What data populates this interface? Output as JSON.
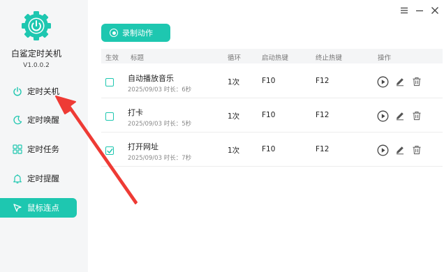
{
  "app": {
    "name": "白鲨定时关机",
    "version": "V1.0.0.2"
  },
  "sidebar": {
    "items": [
      {
        "label": "定时关机",
        "icon": "power-icon"
      },
      {
        "label": "定时唤醒",
        "icon": "moon-icon"
      },
      {
        "label": "定时任务",
        "icon": "grid-icon"
      },
      {
        "label": "定时提醒",
        "icon": "bell-icon"
      },
      {
        "label": "鼠标连点",
        "icon": "cursor-icon",
        "active": true
      }
    ]
  },
  "toolbar": {
    "record_label": "录制动作"
  },
  "table": {
    "headers": {
      "enabled": "生效",
      "title": "标题",
      "loop": "循环",
      "start_hotkey": "启动热键",
      "stop_hotkey": "终止热键",
      "actions": "操作"
    },
    "rows": [
      {
        "title": "自动播放音乐",
        "meta": "2025/09/03 时长：6秒",
        "loop": "1次",
        "start": "F10",
        "stop": "F12",
        "checked": false
      },
      {
        "title": "打卡",
        "meta": "2025/09/03 时长：5秒",
        "loop": "1次",
        "start": "F10",
        "stop": "F12",
        "checked": false
      },
      {
        "title": "打开网址",
        "meta": "2025/09/03 时长：7秒",
        "loop": "1次",
        "start": "F10",
        "stop": "F12",
        "checked": true
      }
    ]
  },
  "colors": {
    "accent": "#1ec7b0",
    "annotation": "#ee3b35"
  }
}
